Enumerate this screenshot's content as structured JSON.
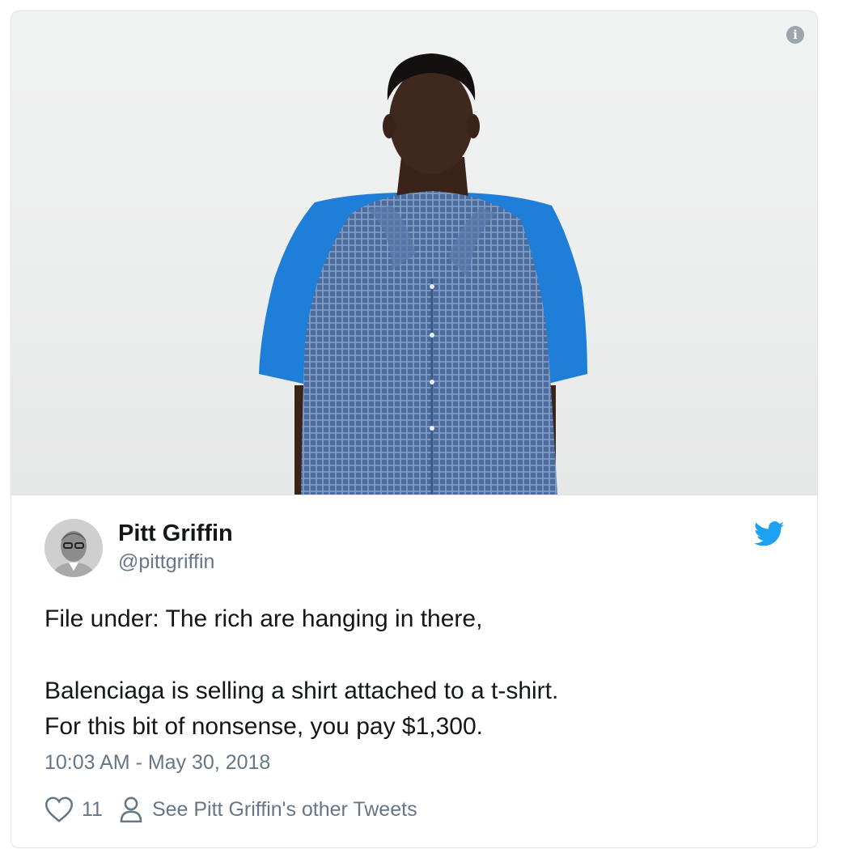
{
  "tweet": {
    "author": {
      "name": "Pitt Griffin",
      "handle": "@pittgriffin"
    },
    "text_lines": [
      "File under: The rich are hanging in there,",
      "Balenciaga is selling a shirt attached to a t-shirt.",
      "For this bit of nonsense, you pay $1,300."
    ],
    "timestamp": "10:03 AM - May 30, 2018",
    "like_count": "11",
    "profile_link_label": "See Pitt Griffin's other Tweets"
  },
  "icons": {
    "info": "info-icon",
    "bird": "twitter-bird-icon",
    "like": "heart-icon",
    "profile": "person-icon"
  },
  "colors": {
    "brand": "#1da1f2",
    "text_primary": "#14171a",
    "text_secondary": "#657786",
    "border": "#dfe5ea"
  }
}
